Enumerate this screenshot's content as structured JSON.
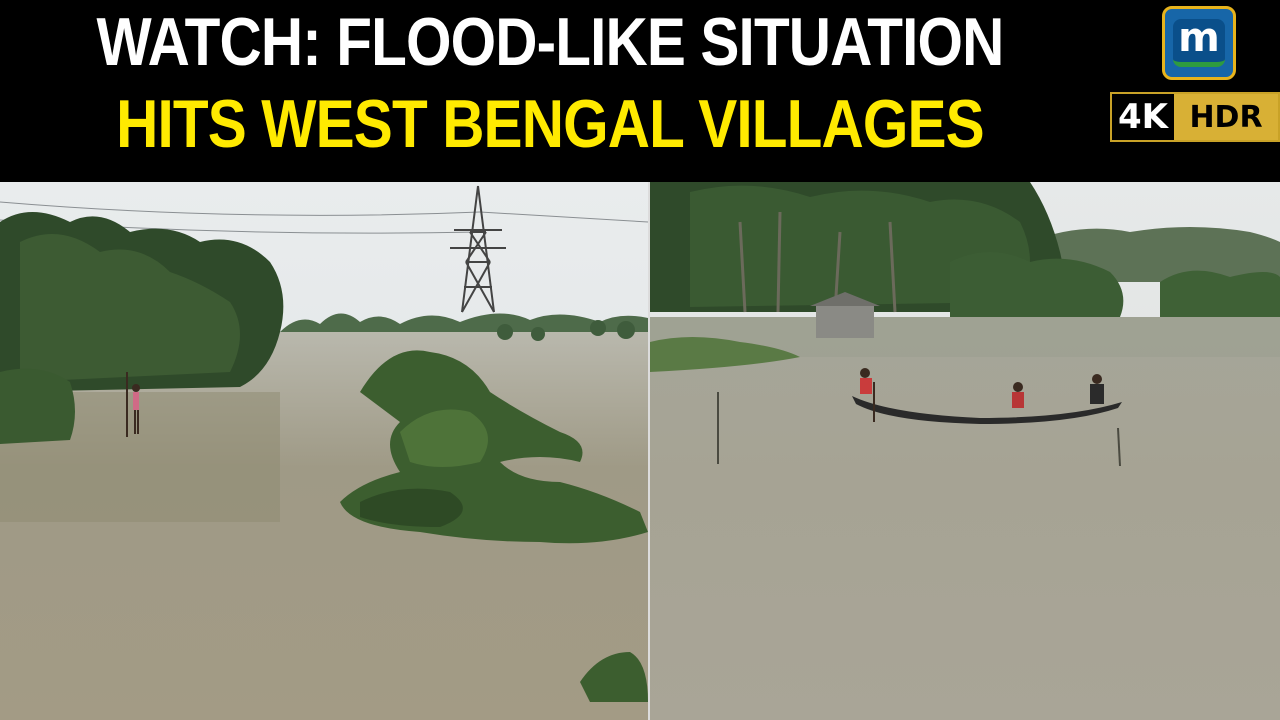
{
  "headline": {
    "line1": "WATCH: FLOOD-LIKE SITUATION",
    "line2": "HITS WEST BENGAL VILLAGES",
    "line1_color": "#ffffff",
    "line2_color": "#ffea00"
  },
  "logo": {
    "letter": "m",
    "icon": "mint-logo-icon",
    "bg_color": "#1766a8",
    "border_color": "#e7b31c"
  },
  "quality_badge": {
    "left": "4K",
    "right": "HDR",
    "accent_color": "#d8b035"
  },
  "photos": {
    "left": {
      "icon": "flooded-field-with-pylon-photo"
    },
    "right": {
      "icon": "boat-on-floodwater-photo"
    }
  }
}
